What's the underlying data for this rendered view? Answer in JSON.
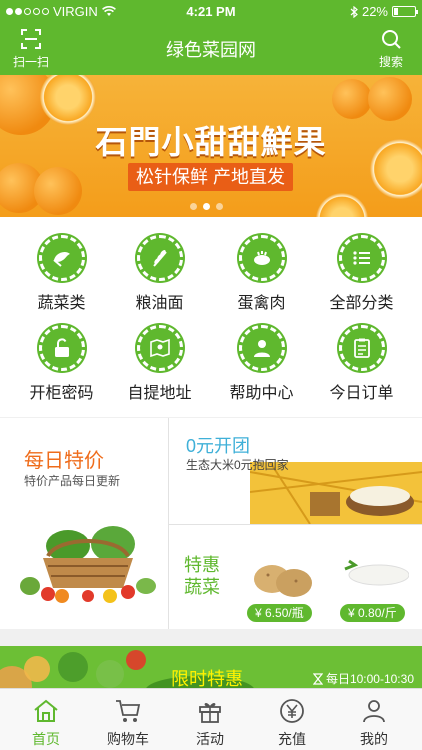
{
  "status_bar": {
    "carrier": "VIRGIN",
    "time": "4:21 PM",
    "battery": "22%",
    "battery_level": 0.22
  },
  "header": {
    "title": "绿色菜园网",
    "scan_label": "扫一扫",
    "search_label": "搜索"
  },
  "banner": {
    "headline": "石門小甜甜鮮果",
    "subtitle": "松针保鲜 产地直发",
    "pages": 3,
    "active_page": 1
  },
  "categories": [
    {
      "label": "蔬菜类",
      "icon": "vegetable-icon"
    },
    {
      "label": "粮油面",
      "icon": "grain-icon"
    },
    {
      "label": "蛋禽肉",
      "icon": "poultry-icon"
    },
    {
      "label": "全部分类",
      "icon": "list-icon"
    },
    {
      "label": "开柜密码",
      "icon": "unlock-icon"
    },
    {
      "label": "自提地址",
      "icon": "map-pin-icon"
    },
    {
      "label": "帮助中心",
      "icon": "help-person-icon"
    },
    {
      "label": "今日订单",
      "icon": "clipboard-icon"
    }
  ],
  "promo": {
    "daily_title": "每日特价",
    "daily_subtitle": "特价产品每日更新",
    "zero_title": "0元开团",
    "zero_subtitle": "生态大米0元抱回家",
    "veg_title": "特惠蔬菜",
    "products": [
      {
        "name": "potato",
        "price": "¥ 6.50/瓶"
      },
      {
        "name": "radish",
        "price": "¥ 0.80/斤"
      }
    ]
  },
  "flash_sale": {
    "title": "限时特惠",
    "time": "每日10:00-10:30"
  },
  "tabs": [
    {
      "label": "首页",
      "icon": "home-icon",
      "active": true
    },
    {
      "label": "购物车",
      "icon": "cart-icon",
      "active": false
    },
    {
      "label": "活动",
      "icon": "gift-icon",
      "active": false
    },
    {
      "label": "充值",
      "icon": "yen-icon",
      "active": false
    },
    {
      "label": "我的",
      "icon": "user-icon",
      "active": false
    }
  ],
  "colors": {
    "brand_green": "#5fb82e",
    "orange_accent": "#ef6c1b",
    "teal_accent": "#3fb0d8",
    "flash_yellow": "#fff200"
  }
}
